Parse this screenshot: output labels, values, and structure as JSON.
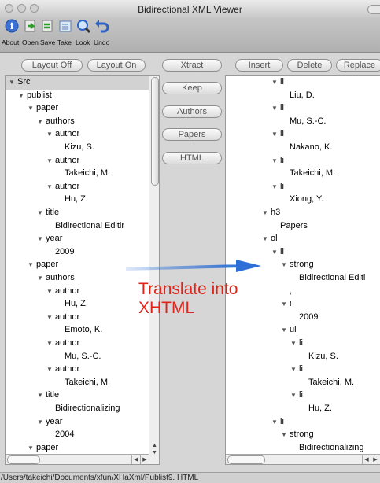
{
  "window": {
    "title": "Bidirectional XML Viewer"
  },
  "toolbar": [
    {
      "label": "About",
      "icon": "info-icon"
    },
    {
      "label": "Open",
      "icon": "open-icon"
    },
    {
      "label": "Save",
      "icon": "save-icon"
    },
    {
      "label": "Take",
      "icon": "take-icon"
    },
    {
      "label": "Look",
      "icon": "look-icon"
    },
    {
      "label": "Undo",
      "icon": "undo-icon"
    }
  ],
  "layout_buttons": {
    "off": "Layout Off",
    "on": "Layout On"
  },
  "middle_buttons": [
    "Xtract",
    "Keep",
    "Authors",
    "Papers",
    "HTML"
  ],
  "right_buttons": [
    "Insert",
    "Delete",
    "Replace"
  ],
  "left_tree": [
    {
      "t": "Src",
      "d": 0,
      "tri": true
    },
    {
      "t": "publist",
      "d": 1,
      "tri": true
    },
    {
      "t": "paper",
      "d": 2,
      "tri": true
    },
    {
      "t": "authors",
      "d": 3,
      "tri": true
    },
    {
      "t": "author",
      "d": 4,
      "tri": true
    },
    {
      "t": "Kizu, S.",
      "d": 5,
      "tri": false
    },
    {
      "t": "author",
      "d": 4,
      "tri": true
    },
    {
      "t": "Takeichi, M.",
      "d": 5,
      "tri": false
    },
    {
      "t": "author",
      "d": 4,
      "tri": true
    },
    {
      "t": "Hu, Z.",
      "d": 5,
      "tri": false
    },
    {
      "t": "title",
      "d": 3,
      "tri": true
    },
    {
      "t": "Bidirectional Editir",
      "d": 4,
      "tri": false
    },
    {
      "t": "year",
      "d": 3,
      "tri": true
    },
    {
      "t": "2009",
      "d": 4,
      "tri": false
    },
    {
      "t": "paper",
      "d": 2,
      "tri": true
    },
    {
      "t": "authors",
      "d": 3,
      "tri": true
    },
    {
      "t": "author",
      "d": 4,
      "tri": true
    },
    {
      "t": "Hu, Z.",
      "d": 5,
      "tri": false
    },
    {
      "t": "author",
      "d": 4,
      "tri": true
    },
    {
      "t": "Emoto, K.",
      "d": 5,
      "tri": false
    },
    {
      "t": "author",
      "d": 4,
      "tri": true
    },
    {
      "t": "Mu, S.-C.",
      "d": 5,
      "tri": false
    },
    {
      "t": "author",
      "d": 4,
      "tri": true
    },
    {
      "t": "Takeichi, M.",
      "d": 5,
      "tri": false
    },
    {
      "t": "title",
      "d": 3,
      "tri": true
    },
    {
      "t": "Bidirectionalizing ",
      "d": 4,
      "tri": false
    },
    {
      "t": "year",
      "d": 3,
      "tri": true
    },
    {
      "t": "2004",
      "d": 4,
      "tri": false
    },
    {
      "t": "paper",
      "d": 2,
      "tri": true
    }
  ],
  "right_tree": [
    {
      "t": "li",
      "d": 3,
      "tri": true
    },
    {
      "t": "Liu, D.",
      "d": 4,
      "tri": false
    },
    {
      "t": "li",
      "d": 3,
      "tri": true
    },
    {
      "t": "Mu, S.-C.",
      "d": 4,
      "tri": false
    },
    {
      "t": "li",
      "d": 3,
      "tri": true
    },
    {
      "t": "Nakano, K.",
      "d": 4,
      "tri": false
    },
    {
      "t": "li",
      "d": 3,
      "tri": true
    },
    {
      "t": "Takeichi, M.",
      "d": 4,
      "tri": false
    },
    {
      "t": "li",
      "d": 3,
      "tri": true
    },
    {
      "t": "Xiong, Y.",
      "d": 4,
      "tri": false
    },
    {
      "t": "h3",
      "d": 2,
      "tri": true
    },
    {
      "t": "Papers",
      "d": 3,
      "tri": false
    },
    {
      "t": "ol",
      "d": 2,
      "tri": true
    },
    {
      "t": "li",
      "d": 3,
      "tri": true
    },
    {
      "t": "strong",
      "d": 4,
      "tri": true
    },
    {
      "t": "Bidirectional Editi",
      "d": 5,
      "tri": false
    },
    {
      "t": ",",
      "d": 4,
      "tri": false
    },
    {
      "t": "i",
      "d": 4,
      "tri": true
    },
    {
      "t": "2009",
      "d": 5,
      "tri": false
    },
    {
      "t": "ul",
      "d": 4,
      "tri": true
    },
    {
      "t": "li",
      "d": 5,
      "tri": true
    },
    {
      "t": "Kizu, S.",
      "d": 6,
      "tri": false
    },
    {
      "t": "li",
      "d": 5,
      "tri": true
    },
    {
      "t": "Takeichi, M.",
      "d": 6,
      "tri": false
    },
    {
      "t": "li",
      "d": 5,
      "tri": true
    },
    {
      "t": "Hu, Z.",
      "d": 6,
      "tri": false
    },
    {
      "t": "li",
      "d": 3,
      "tri": true
    },
    {
      "t": "strong",
      "d": 4,
      "tri": true
    },
    {
      "t": "Bidirectionalizing",
      "d": 5,
      "tri": false
    }
  ],
  "annotation": {
    "line1": "Translate into",
    "line2": "XHTML",
    "color": "#e2231a"
  },
  "status": "/Users/takeichi/Documents/xfun/XHaXml/Publist9.  HTML"
}
